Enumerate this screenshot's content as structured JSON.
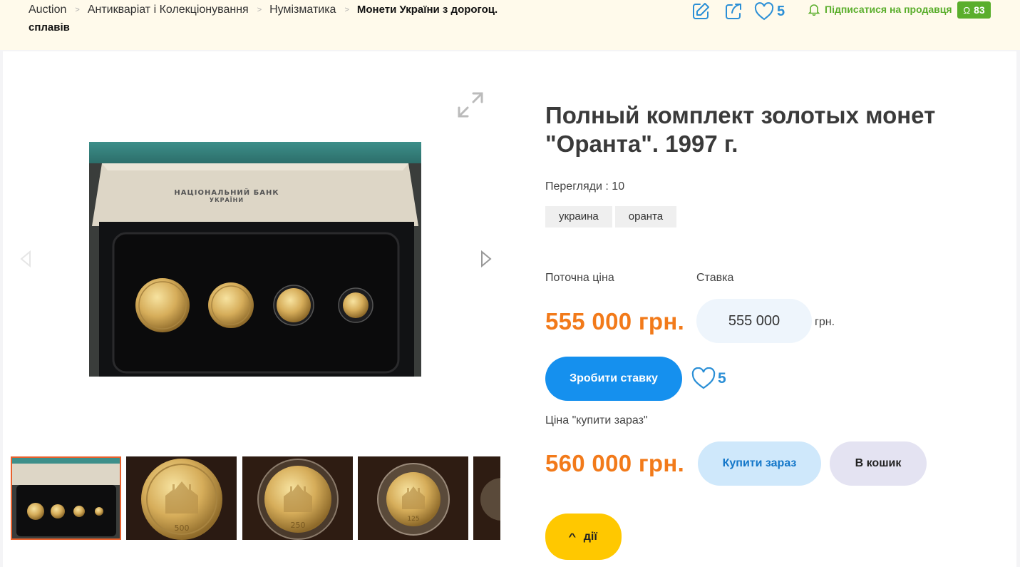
{
  "breadcrumbs": {
    "items": [
      "Auction",
      "Антикваріат і Колекціонування",
      "Нумізматика"
    ],
    "current": "Монети України з дорогоц. сплавів",
    "separator": ">"
  },
  "header": {
    "likes_count": "5",
    "subscribe_label": "Підписатися на продавця",
    "rating_symbol": "Ω",
    "rating_value": "83"
  },
  "lot": {
    "title": "Полный комплект золотых монет \"Оранта\". 1997 г.",
    "views_label": "Перегляди : 10",
    "tags": [
      "украина",
      "оранта"
    ],
    "current_price_label": "Поточна ціна",
    "current_price": "555 000 грн.",
    "bid_label": "Ставка",
    "bid_value": "555 000",
    "bid_unit": "грн.",
    "bid_button": "Зробити ставку",
    "likes_count": "5",
    "buy_now_label": "Ціна \"купити зараз\"",
    "buy_now_price": "560 000 грн.",
    "buy_now_button": "Купити зараз",
    "cart_button": "В кошик",
    "actions_button": "дії"
  },
  "gallery": {
    "box_text_line1": "НАЦІОНАЛЬНИЙ БАНК",
    "box_text_line2": "УКРАЇНИ",
    "thumb_coin_labels": [
      "500",
      "250",
      "125"
    ],
    "selected_thumb": 1
  },
  "colors": {
    "accent_blue": "#1590ee",
    "price_orange": "#f27a1a",
    "seller_green": "#5aae2c",
    "actions_yellow": "#ffc800",
    "topbar_bg": "#fffaeb"
  }
}
